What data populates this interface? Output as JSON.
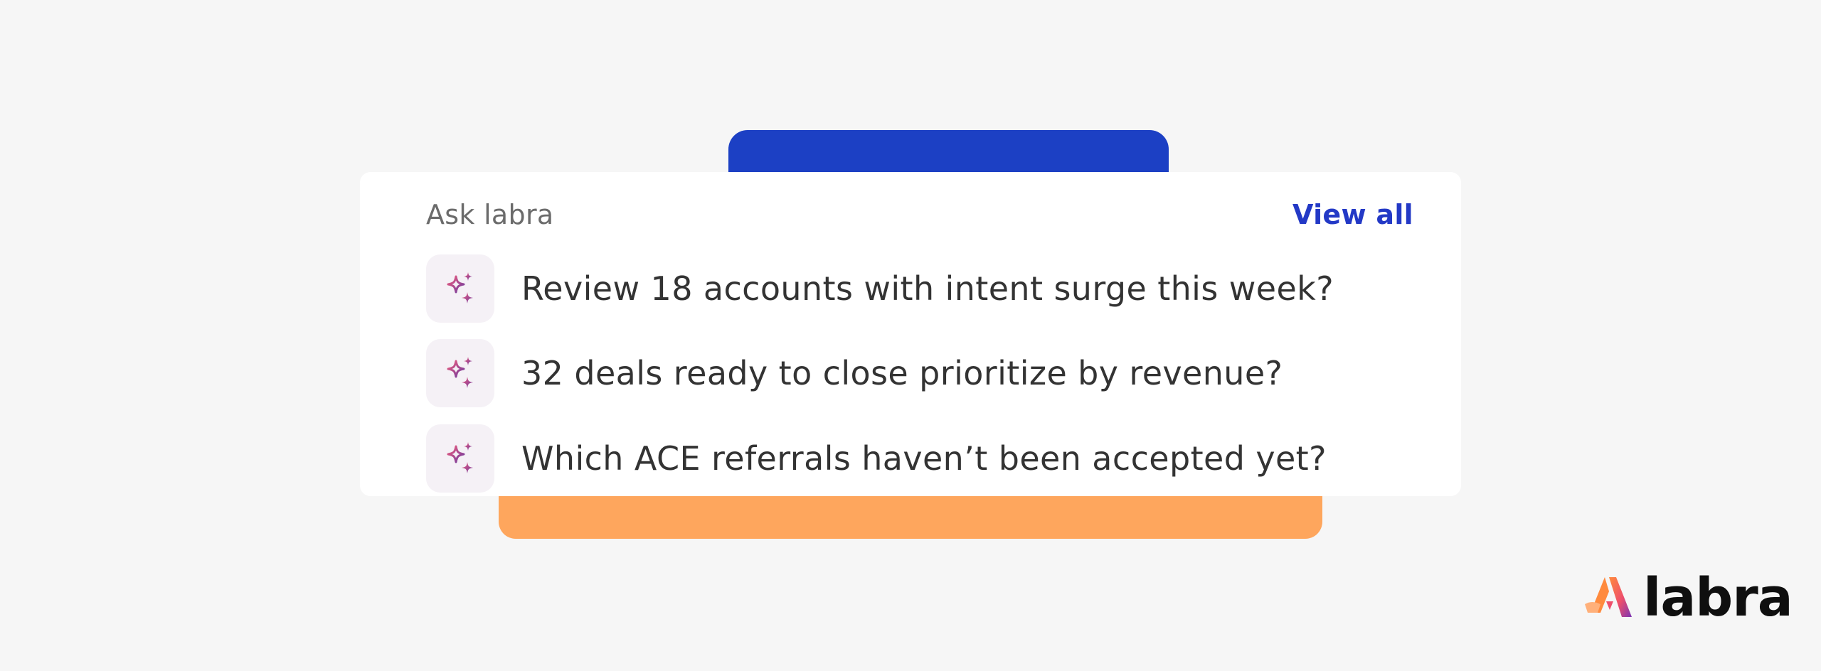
{
  "card": {
    "title": "Ask labra",
    "view_all_label": "View all",
    "prompts": [
      {
        "icon": "sparkles-icon",
        "text": "Review 18 accounts with intent surge this week?"
      },
      {
        "icon": "sparkles-icon",
        "text": "32 deals ready to close prioritize by revenue?"
      },
      {
        "icon": "sparkles-icon",
        "text": "Which ACE referrals haven’t been accepted yet?"
      }
    ]
  },
  "brand": {
    "name": "labra",
    "logo_icon": "labra-logo-icon"
  },
  "colors": {
    "background": "#f6f6f6",
    "accent_blue": "#1c40c4",
    "accent_orange": "#fea65d",
    "link": "#2339c6"
  }
}
